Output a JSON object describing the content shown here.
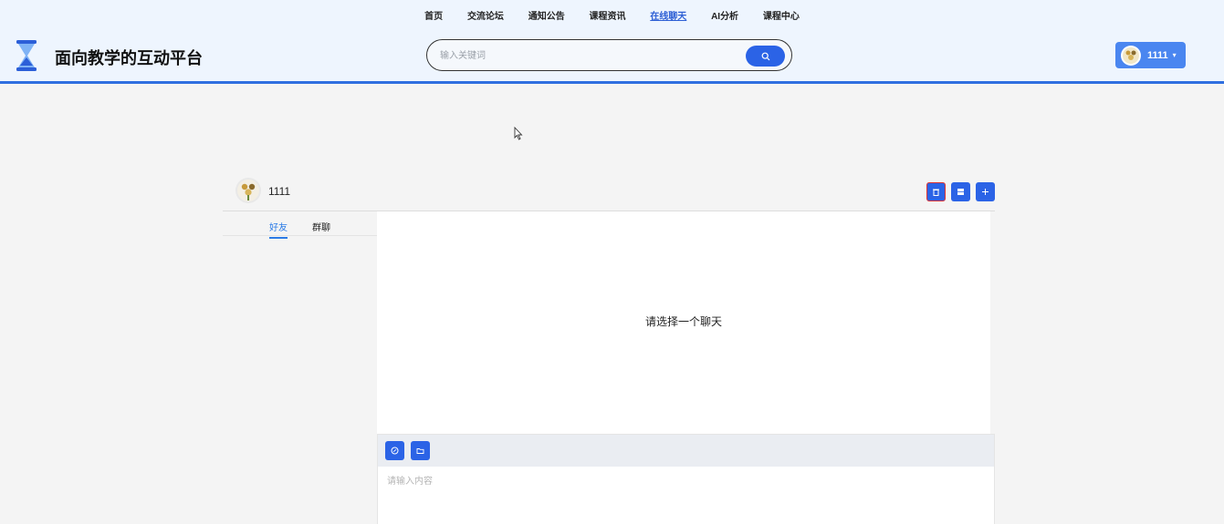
{
  "nav": {
    "items": [
      {
        "label": "首页"
      },
      {
        "label": "交流论坛"
      },
      {
        "label": "通知公告"
      },
      {
        "label": "课程资讯"
      },
      {
        "label": "在线聊天",
        "active": true
      },
      {
        "label": "AI分析"
      },
      {
        "label": "课程中心"
      }
    ]
  },
  "header": {
    "brand": "面向教学的互动平台",
    "search_placeholder": "输入关键词",
    "user_name": "1111"
  },
  "chat": {
    "current_user": "1111",
    "tabs": [
      "好友",
      "群聊"
    ],
    "empty_text": "请选择一个聊天",
    "input_placeholder": "请输入内容"
  },
  "colors": {
    "accent": "#2b63e6",
    "header_bg": "#eef5fe",
    "active_nav": "#2d5fd5"
  }
}
